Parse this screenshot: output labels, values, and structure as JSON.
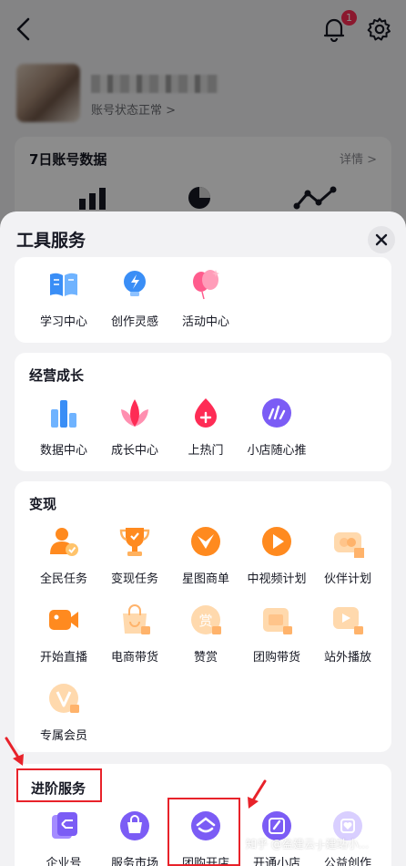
{
  "background": {
    "notification_count": "1",
    "account_status": "账号状态正常 >",
    "data_card": {
      "title": "7日账号数据",
      "more": "详情 >"
    }
  },
  "sheet": {
    "title": "工具服务",
    "sections": {
      "tools": {
        "items": [
          {
            "label": "学习中心",
            "icon": "book-icon"
          },
          {
            "label": "创作灵感",
            "icon": "bulb-icon"
          },
          {
            "label": "活动中心",
            "icon": "balloon-icon"
          }
        ]
      },
      "growth": {
        "title": "经营成长",
        "items": [
          {
            "label": "数据中心",
            "icon": "bar-chart-icon"
          },
          {
            "label": "成长中心",
            "icon": "lotus-icon"
          },
          {
            "label": "上热门",
            "icon": "flame-icon"
          },
          {
            "label": "小店随心推",
            "icon": "promote-icon"
          }
        ]
      },
      "monetize": {
        "title": "变现",
        "items": [
          {
            "label": "全民任务",
            "icon": "person-task-icon"
          },
          {
            "label": "变现任务",
            "icon": "trophy-icon"
          },
          {
            "label": "星图商单",
            "icon": "star-map-icon"
          },
          {
            "label": "中视频计划",
            "icon": "video-play-icon"
          },
          {
            "label": "伙伴计划",
            "icon": "partner-icon"
          },
          {
            "label": "开始直播",
            "icon": "camera-icon"
          },
          {
            "label": "电商带货",
            "icon": "shopping-bag-icon"
          },
          {
            "label": "赞赏",
            "icon": "reward-icon"
          },
          {
            "label": "团购带货",
            "icon": "group-buy-icon"
          },
          {
            "label": "站外播放",
            "icon": "external-play-icon"
          },
          {
            "label": "专属会员",
            "icon": "vip-icon"
          }
        ]
      },
      "advanced": {
        "title": "进阶服务",
        "items": [
          {
            "label": "企业号",
            "icon": "enterprise-icon"
          },
          {
            "label": "服务市场",
            "icon": "service-market-icon"
          },
          {
            "label": "团购开店",
            "icon": "group-shop-icon"
          },
          {
            "label": "开通小店",
            "icon": "open-shop-icon"
          },
          {
            "label": "公益创作",
            "icon": "charity-icon"
          }
        ]
      }
    }
  },
  "watermark": "知乎 @盈建云-J-建站小...",
  "colors": {
    "accent_red": "#e8222a",
    "blue": "#3a8ef6",
    "pink": "#fe2c55",
    "orange": "#ff8a1f",
    "purple": "#7b5cf5"
  }
}
